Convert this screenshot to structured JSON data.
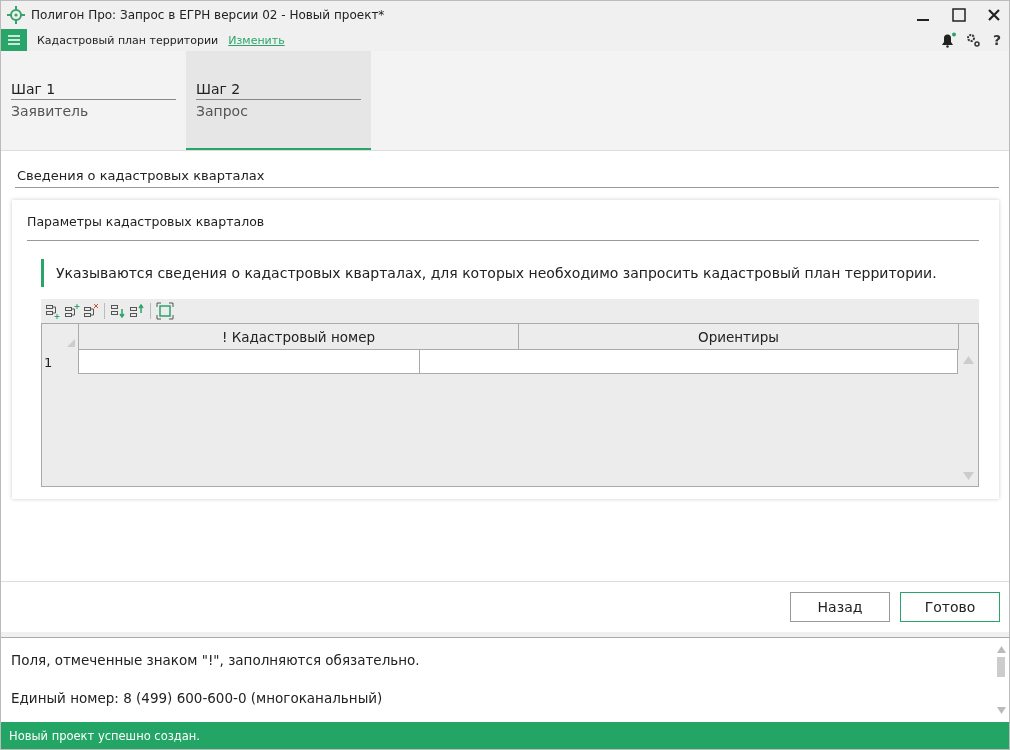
{
  "window": {
    "title": "Полигон Про: Запрос в ЕГРН версии 02 - Новый проект*"
  },
  "menu_bar": {
    "document_type": "Кадастровый план территории",
    "change_link": "Изменить",
    "has_notification": true,
    "help": "?"
  },
  "steps": [
    {
      "title": "Шаг 1",
      "subtitle": "Заявитель",
      "selected": false
    },
    {
      "title": "Шаг 2",
      "subtitle": "Запрос",
      "selected": true
    }
  ],
  "section": {
    "title": "Сведения о кадастровых кварталах"
  },
  "panel": {
    "title": "Параметры кадастровых кварталов",
    "hint": "Указываются сведения о кадастровых кварталах, для которых необходимо запросить кадастровый план территории."
  },
  "table": {
    "columns": [
      "! Кадастровый номер",
      "Ориентиры"
    ],
    "rows": [
      {
        "number": "1",
        "cells": [
          "",
          ""
        ]
      }
    ]
  },
  "buttons": [
    {
      "label": "Назад",
      "primary": false
    },
    {
      "label": "Готово",
      "primary": true
    }
  ],
  "info": [
    "Поля, отмеченные знаком \"!\", заполняются обязательно.",
    "Единый номер: 8 (499) 600-600-0 (многоканальный)"
  ],
  "status_bar": "Новый проект успешно создан."
}
